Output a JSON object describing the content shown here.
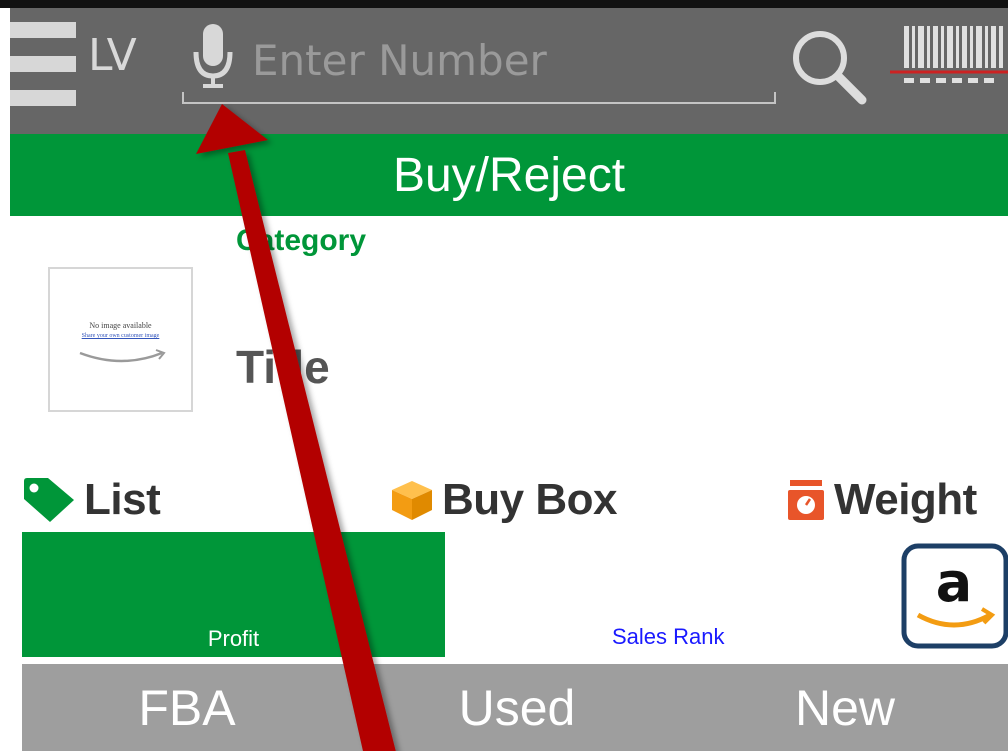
{
  "app_bar": {
    "lv_label": "LV",
    "search": {
      "value": "",
      "placeholder": "Enter Number"
    },
    "icons": [
      "menu-icon",
      "microphone-icon",
      "search-icon",
      "barcode-scanner-icon"
    ]
  },
  "banner": {
    "label": "Buy/Reject",
    "color": "#009639"
  },
  "product": {
    "category_label": "Category",
    "title_label": "Title",
    "image": {
      "no_image_text": "No image available",
      "link_text": "Share your own customer image"
    }
  },
  "stats": {
    "list_label": "List",
    "buy_box_label": "Buy Box",
    "weight_label": "Weight",
    "icons": [
      "tag-icon",
      "box-icon",
      "scale-icon"
    ]
  },
  "metrics": {
    "profit_label": "Profit",
    "sales_rank_label": "Sales Rank",
    "marketplace_icon": "amazon-logo-icon"
  },
  "tabs": [
    {
      "label": "FBA"
    },
    {
      "label": "Used"
    },
    {
      "label": "New"
    }
  ],
  "colors": {
    "accent_green": "#009639",
    "app_bar": "#666666",
    "tab_bar": "#9e9e9e",
    "annotation_arrow": "#b30000",
    "sales_rank_text": "#1a1aff"
  }
}
